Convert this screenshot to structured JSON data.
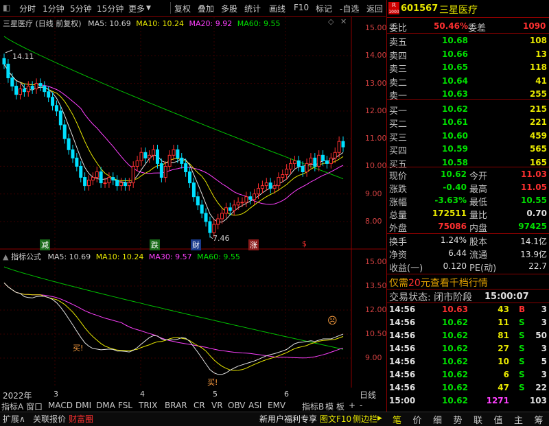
{
  "toolbar": {
    "periods": [
      "分时",
      "1分钟",
      "5分钟",
      "15分钟",
      "更多"
    ],
    "tools": [
      "复权",
      "叠加",
      "多股",
      "统计",
      "画线",
      "F10",
      "标记",
      "-自选",
      "返回"
    ]
  },
  "chart": {
    "title": "三星医疗 (日线 前复权)",
    "ma": [
      "MA5: 10.69",
      "MA10: 10.24",
      "MA20: 9.92",
      "MA60: 9.55"
    ],
    "y_ticks": [
      "15.00",
      "14.00",
      "13.00",
      "12.00",
      "11.00",
      "10.00",
      "9.00",
      "8.00"
    ],
    "high_label": "14.11",
    "low_label": "7.46",
    "markers": [
      "减",
      "跌",
      "财",
      "涨",
      "$"
    ],
    "indicator_title": "指标公式",
    "indicator_ma": [
      "MA5: 10.69",
      "MA10: 10.24",
      "MA30: 9.57",
      "MA60: 9.55"
    ],
    "ind_y_ticks": [
      "15.00",
      "13.50",
      "12.00",
      "10.50",
      "9.00"
    ],
    "buy_label": "买!",
    "x_labels": [
      "2022年",
      "3",
      "4",
      "5",
      "6"
    ],
    "period_label": "日线"
  },
  "chart_data": {
    "type": "line",
    "title": "三星医疗 (日线 前复权)",
    "ylim": [
      7.5,
      15.2
    ],
    "close": [
      13.7,
      13.2,
      12.9,
      12.6,
      12.8,
      12.7,
      12.9,
      12.8,
      13.0,
      12.9,
      12.7,
      12.5,
      12.2,
      12.0,
      11.5,
      11.0,
      10.6,
      10.3,
      10.0,
      9.6,
      9.3,
      9.5,
      9.6,
      9.8,
      9.4,
      9.4,
      9.6,
      9.5,
      9.3,
      9.4,
      9.3,
      9.4,
      10.0,
      10.2,
      10.5,
      10.3,
      10.4,
      10.6,
      10.1,
      9.6,
      10.0,
      10.4,
      10.6,
      10.3,
      10.1,
      9.8,
      9.4,
      8.9,
      8.6,
      8.3,
      8.0,
      7.6,
      7.9,
      8.1,
      8.3,
      8.5,
      8.4,
      8.6,
      8.7,
      8.7,
      8.9,
      8.8,
      9.0,
      9.2,
      9.3,
      9.4,
      9.2,
      9.3,
      9.6,
      9.7,
      9.9,
      10.1,
      10.2,
      10.0,
      9.8,
      10.1,
      10.3,
      10.0,
      10.4,
      10.2,
      10.1,
      10.3,
      10.5,
      10.9,
      10.7
    ]
  },
  "quote": {
    "logo": "R",
    "logo_sub": "1000",
    "code": "601567",
    "name": "三星医疗",
    "weibi_label": "委比",
    "weibi": "50.46%",
    "weicha_label": "委差",
    "weicha": "1090",
    "sells": [
      {
        "label": "卖五",
        "price": "10.68",
        "vol": "108"
      },
      {
        "label": "卖四",
        "price": "10.66",
        "vol": "13"
      },
      {
        "label": "卖三",
        "price": "10.65",
        "vol": "118"
      },
      {
        "label": "卖二",
        "price": "10.64",
        "vol": "41"
      },
      {
        "label": "卖一",
        "price": "10.63",
        "vol": "255"
      }
    ],
    "buys": [
      {
        "label": "买一",
        "price": "10.62",
        "vol": "215"
      },
      {
        "label": "买二",
        "price": "10.61",
        "vol": "221"
      },
      {
        "label": "买三",
        "price": "10.60",
        "vol": "459"
      },
      {
        "label": "买四",
        "price": "10.59",
        "vol": "565"
      },
      {
        "label": "买五",
        "price": "10.58",
        "vol": "165"
      }
    ],
    "stats": [
      {
        "l1": "现价",
        "v1": "10.62",
        "l2": "今开",
        "v2": "11.03"
      },
      {
        "l1": "涨跌",
        "v1": "-0.40",
        "l2": "最高",
        "v2": "11.05"
      },
      {
        "l1": "涨幅",
        "v1": "-3.63%",
        "l2": "最低",
        "v2": "10.55"
      },
      {
        "l1": "总量",
        "v1": "172511",
        "l2": "量比",
        "v2": "0.70"
      },
      {
        "l1": "外盘",
        "v1": "75086",
        "l2": "内盘",
        "v2": "97425"
      }
    ],
    "stats2": [
      {
        "l1": "换手",
        "v1": "1.24%",
        "l2": "股本",
        "v2": "14.1亿"
      },
      {
        "l1": "净资",
        "v1": "6.44",
        "l2": "流通",
        "v2": "13.9亿"
      },
      {
        "l1": "收益(一)",
        "v1": "0.120",
        "l2": "PE(动)",
        "v2": "22.7"
      }
    ],
    "promo_pre": "仅需",
    "promo_num": "20",
    "promo_post": "元查看千档行情",
    "trade_status": "交易状态: 闭市阶段",
    "trade_time": "15:00:07",
    "ticks": [
      {
        "time": "14:56",
        "price": "10.63",
        "vol": "43",
        "bs": "B",
        "n": "3"
      },
      {
        "time": "14:56",
        "price": "10.62",
        "vol": "11",
        "bs": "S",
        "n": "3"
      },
      {
        "time": "14:56",
        "price": "10.62",
        "vol": "81",
        "bs": "S",
        "n": "50"
      },
      {
        "time": "14:56",
        "price": "10.62",
        "vol": "27",
        "bs": "S",
        "n": "3"
      },
      {
        "time": "14:56",
        "price": "10.62",
        "vol": "10",
        "bs": "S",
        "n": "5"
      },
      {
        "time": "14:56",
        "price": "10.62",
        "vol": "6",
        "bs": "S",
        "n": "3"
      },
      {
        "time": "14:56",
        "price": "10.62",
        "vol": "47",
        "bs": "S",
        "n": "22"
      },
      {
        "time": "15:00",
        "price": "10.62",
        "vol": "1271",
        "bs": "",
        "n": "103"
      }
    ],
    "tabs": [
      "笔",
      "价",
      "细",
      "势",
      "联",
      "值",
      "主",
      "筹"
    ]
  },
  "indicator_tabs": [
    "指标A",
    "窗口",
    "MACD",
    "DMI",
    "DMA",
    "FSL",
    "TRIX",
    "BRAR",
    "CR",
    "VR",
    "OBV",
    "ASI",
    "EMV",
    "指标B",
    "模",
    "板",
    "+",
    "-"
  ],
  "status": {
    "expand": "扩展∧",
    "related": "关联报价",
    "caifu": "财富圈",
    "welfare": "新用户福利专享",
    "f10": "图文F10",
    "sidebar": "侧边栏"
  }
}
